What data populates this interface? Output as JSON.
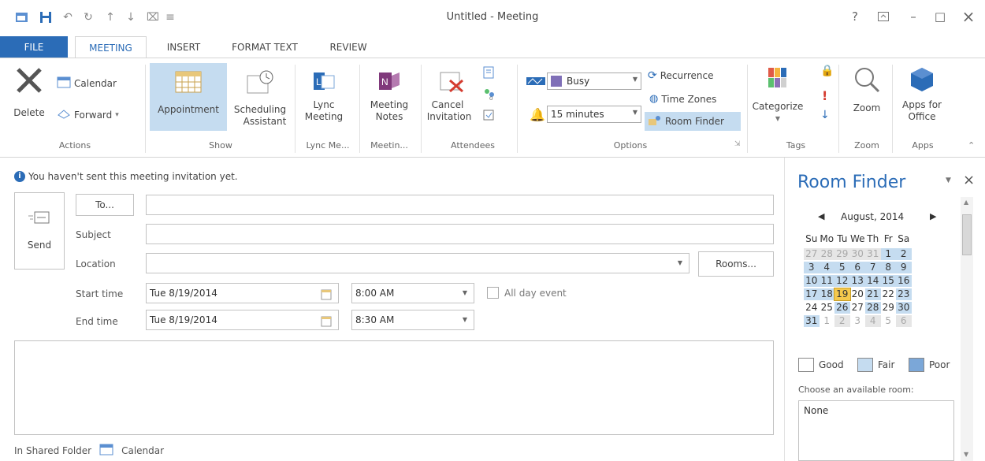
{
  "window": {
    "title": "Untitled - Meeting",
    "help": "?",
    "minimize": "–",
    "maximize": "□",
    "close": "×"
  },
  "tabs": [
    "FILE",
    "MEETING",
    "INSERT",
    "FORMAT TEXT",
    "REVIEW"
  ],
  "ribbon": {
    "actions": {
      "delete": "Delete",
      "calendar": "Calendar",
      "forward": "Forward",
      "label": "Actions"
    },
    "show": {
      "appointment": "Appointment",
      "scheduling_1": "Scheduling",
      "scheduling_2": "Assistant",
      "label": "Show"
    },
    "lync": {
      "lync_1": "Lync",
      "lync_2": "Meeting",
      "label": "Lync Me..."
    },
    "meeting_notes": {
      "line1": "Meeting",
      "line2": "Notes",
      "label": "Meetin..."
    },
    "attendees": {
      "cancel_1": "Cancel",
      "cancel_2": "Invitation",
      "label": "Attendees"
    },
    "options": {
      "show_as": "Busy",
      "reminder": "15 minutes",
      "recurrence": "Recurrence",
      "time_zones": "Time Zones",
      "room_finder": "Room Finder",
      "label": "Options"
    },
    "tags": {
      "categorize": "Categorize",
      "label": "Tags"
    },
    "zoom": {
      "zoom": "Zoom",
      "label": "Zoom"
    },
    "apps": {
      "line1": "Apps for",
      "line2": "Office",
      "label": "Apps"
    }
  },
  "info_bar": "You haven't sent this meeting invitation yet.",
  "form": {
    "send": "Send",
    "to": "To...",
    "subject": "Subject",
    "location": "Location",
    "rooms": "Rooms...",
    "start_time_label": "Start time",
    "end_time_label": "End time",
    "start_date": "Tue 8/19/2014",
    "end_date": "Tue 8/19/2014",
    "start_time": "8:00 AM",
    "end_time": "8:30 AM",
    "all_day": "All day event"
  },
  "footer": {
    "shared": "In Shared Folder",
    "calendar": "Calendar"
  },
  "room_finder": {
    "title": "Room Finder",
    "month": "August, 2014",
    "weekdays": [
      "Su",
      "Mo",
      "Tu",
      "We",
      "Th",
      "Fr",
      "Sa"
    ],
    "weeks": [
      [
        "27",
        "28",
        "29",
        "30",
        "31",
        "1",
        "2"
      ],
      [
        "3",
        "4",
        "5",
        "6",
        "7",
        "8",
        "9"
      ],
      [
        "10",
        "11",
        "12",
        "13",
        "14",
        "15",
        "16"
      ],
      [
        "17",
        "18",
        "19",
        "20",
        "21",
        "22",
        "23"
      ],
      [
        "24",
        "25",
        "26",
        "27",
        "28",
        "29",
        "30"
      ],
      [
        "31",
        "1",
        "2",
        "3",
        "4",
        "5",
        "6"
      ]
    ],
    "good": "Good",
    "fair": "Fair",
    "poor": "Poor",
    "choose": "Choose an available room:",
    "none": "None",
    "colors": {
      "fair": "#c5dcf0",
      "poor": "#7ba7d8",
      "today": "#f5c84c"
    }
  }
}
